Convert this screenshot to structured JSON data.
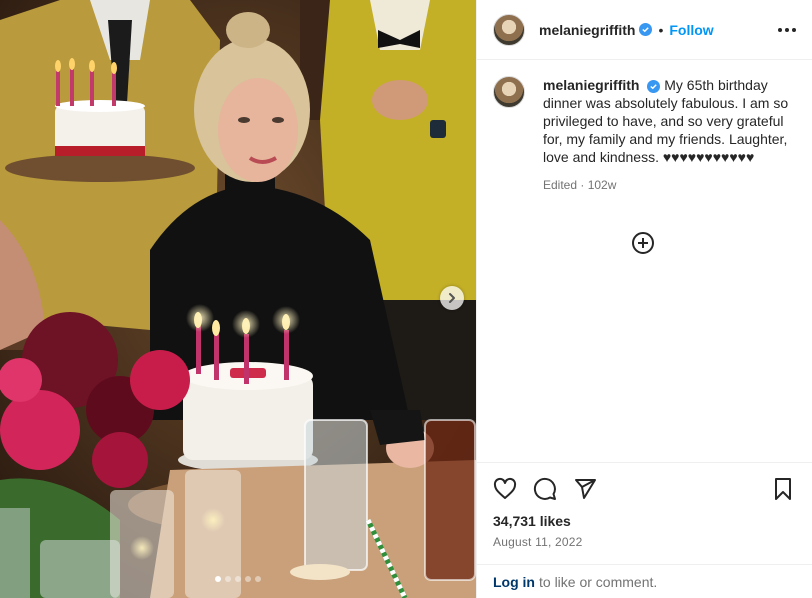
{
  "post": {
    "username": "melaniegriffith",
    "follow_label": "Follow",
    "separator": "•",
    "caption": "My 65th birthday dinner was absolutely fabulous. I am so privileged to have, and so very grateful for, my family and my friends. Laughter, love and kindness. ♥♥♥♥♥♥♥♥♥♥♥",
    "edited_meta": "Edited · 102w",
    "likes": "34,731 likes",
    "date": "August 11, 2022"
  },
  "footer": {
    "login_label": "Log in",
    "login_rest": "to like or comment."
  },
  "carousel": {
    "slide_count": 5,
    "active_index": 0
  },
  "icons": {
    "verified": "verified-badge-icon",
    "more": "more-options-icon",
    "add_comment": "add-comment-icon",
    "like": "heart-icon",
    "comment": "comment-icon",
    "share": "share-icon",
    "save": "bookmark-icon",
    "next": "chevron-right-icon"
  },
  "colors": {
    "accent": "#0095f6",
    "verified": "#3897f0",
    "link": "#00376b",
    "muted": "#737373"
  }
}
